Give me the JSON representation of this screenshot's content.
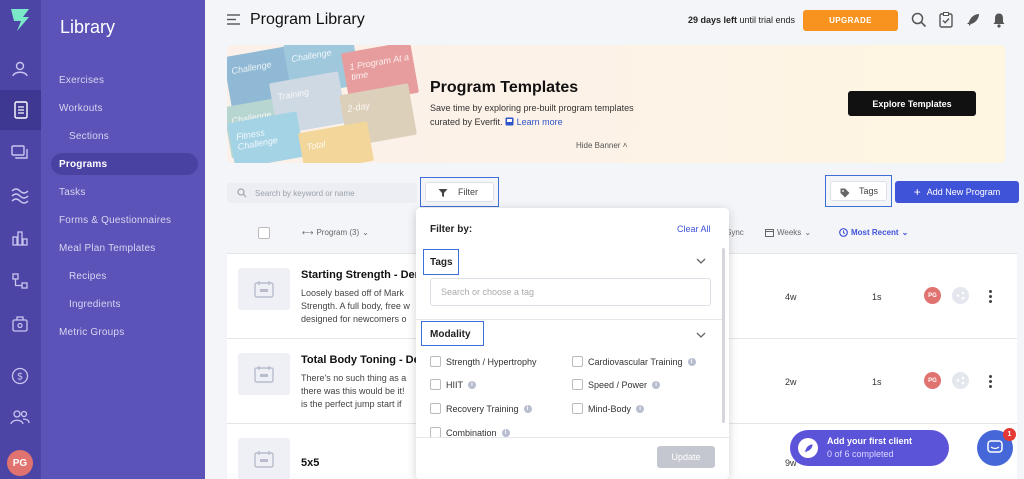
{
  "user": {
    "initials": "PG"
  },
  "sidebar": {
    "title": "Library",
    "items": [
      {
        "label": "Exercises"
      },
      {
        "label": "Workouts"
      },
      {
        "label": "Sections"
      },
      {
        "label": "Programs"
      },
      {
        "label": "Tasks"
      },
      {
        "label": "Forms & Questionnaires"
      },
      {
        "label": "Meal Plan Templates"
      },
      {
        "label": "Recipes"
      },
      {
        "label": "Ingredients"
      },
      {
        "label": "Metric Groups"
      }
    ]
  },
  "header": {
    "title": "Program Library",
    "trial_days": "29 days left",
    "trial_suffix": " until trial ends",
    "upgrade_label": "UPGRADE"
  },
  "banner": {
    "title": "Program Templates",
    "description": "Save time by exploring pre-built program templates curated by Everfit.",
    "learn_more": "Learn more",
    "explore_label": "Explore Templates",
    "hide_label": "Hide Banner",
    "tiles": [
      "Challenge",
      "1 Program At a time",
      "Challenge",
      "Training",
      "2-day",
      "Fitness Challenge",
      "Total"
    ]
  },
  "toolbar": {
    "search_placeholder": "Search by keyword or name",
    "filter_label": "Filter",
    "tags_label": "Tags",
    "add_label": "Add New Program"
  },
  "table": {
    "col_program": "Program (3)",
    "col_sync": "Sync",
    "col_weeks": "Weeks",
    "col_sort": "Most Recent",
    "rows": [
      {
        "title": "Starting Strength - Der",
        "desc": [
          "Loosely based off of Mark",
          "Strength. A full body, free w",
          "designed for newcomers o"
        ],
        "weeks": "4w",
        "sync": "1s",
        "owner": "PG"
      },
      {
        "title": "Total Body Toning - De",
        "desc": [
          "There's no such thing as a",
          "there was this would be it!",
          "is the perfect jump start if"
        ],
        "weeks": "2w",
        "sync": "1s",
        "owner": "PG"
      },
      {
        "title": "5x5",
        "desc": [],
        "weeks": "9w",
        "sync": "",
        "owner": ""
      }
    ]
  },
  "filter_popup": {
    "heading": "Filter by:",
    "clear_all": "Clear All",
    "tags_section": "Tags",
    "tags_placeholder": "Search or choose a tag",
    "modality_section": "Modality",
    "options": [
      "Strength / Hypertrophy",
      "Cardiovascular Training",
      "HIIT",
      "Speed / Power",
      "Recovery Training",
      "Mind-Body",
      "Combination"
    ],
    "update_label": "Update"
  },
  "onboarding": {
    "title": "Add your first client",
    "progress": "0 of 6 completed"
  },
  "chat": {
    "badge": "1"
  },
  "colors": {
    "rail": "#4d45a6",
    "sidebar": "#5b53b7",
    "accent": "#3f53d9",
    "upgrade": "#f7931e"
  }
}
